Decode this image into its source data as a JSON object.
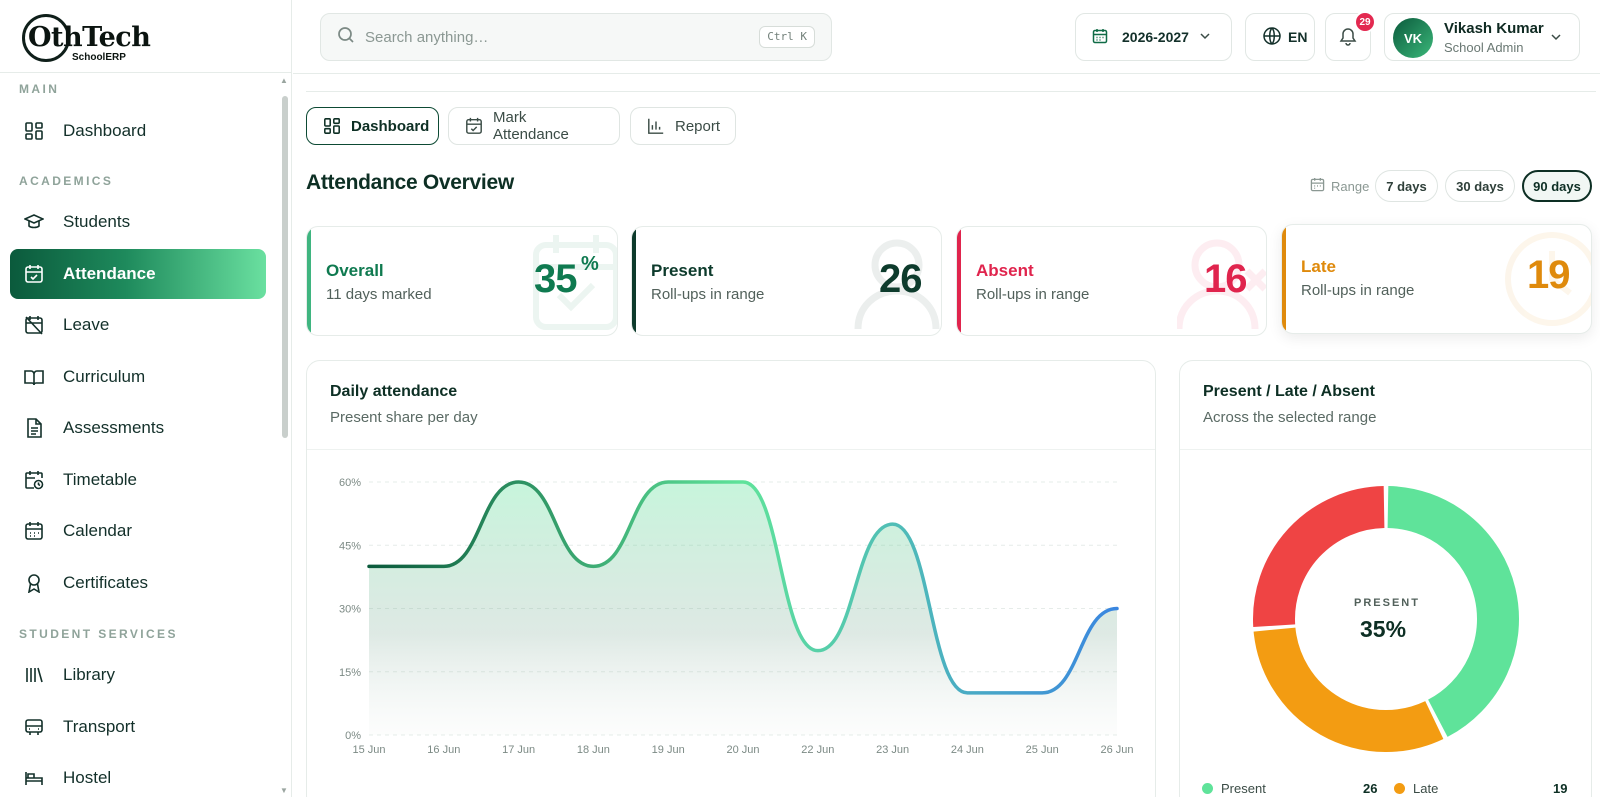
{
  "brand": {
    "name": "OthTech",
    "sub": "SchoolERP"
  },
  "sidebar": {
    "sections": [
      {
        "label": "MAIN"
      },
      {
        "label": "ACADEMICS"
      },
      {
        "label": "STUDENT SERVICES"
      }
    ],
    "items": [
      {
        "label": "Dashboard",
        "icon": "dashboard-icon"
      },
      {
        "label": "Students",
        "icon": "graduation-cap-icon"
      },
      {
        "label": "Attendance",
        "icon": "calendar-check-icon",
        "active": true
      },
      {
        "label": "Leave",
        "icon": "calendar-off-icon"
      },
      {
        "label": "Curriculum",
        "icon": "book-open-icon"
      },
      {
        "label": "Assessments",
        "icon": "file-text-icon"
      },
      {
        "label": "Timetable",
        "icon": "calendar-clock-icon"
      },
      {
        "label": "Calendar",
        "icon": "calendar-icon"
      },
      {
        "label": "Certificates",
        "icon": "award-icon"
      },
      {
        "label": "Library",
        "icon": "library-icon"
      },
      {
        "label": "Transport",
        "icon": "bus-icon"
      },
      {
        "label": "Hostel",
        "icon": "bed-icon"
      }
    ]
  },
  "header": {
    "search": {
      "placeholder": "Search anything…",
      "shortcut": "Ctrl K"
    },
    "academic_year": "2026-2027",
    "language": "EN",
    "notifications": {
      "count": "29"
    },
    "user": {
      "initials": "VK",
      "name": "Vikash Kumar",
      "role": "School Admin"
    }
  },
  "tabs": [
    {
      "label": "Dashboard",
      "icon": "dashboard-icon",
      "active": true
    },
    {
      "label": "Mark Attendance",
      "icon": "calendar-check-icon"
    },
    {
      "label": "Report",
      "icon": "bar-chart-icon"
    }
  ],
  "page": {
    "title": "Attendance Overview",
    "range_label": "Range",
    "range_options": [
      {
        "label": "7 days"
      },
      {
        "label": "30 days"
      },
      {
        "label": "90 days",
        "active": true
      }
    ]
  },
  "stats": {
    "overall": {
      "label": "Overall",
      "sub": "11 days marked",
      "value": "35",
      "unit": "%",
      "color": "#0f7a50"
    },
    "present": {
      "label": "Present",
      "sub": "Roll-ups in range",
      "value": "26",
      "color": "#0d3b2c"
    },
    "absent": {
      "label": "Absent",
      "sub": "Roll-ups in range",
      "value": "16",
      "color": "#e0244d"
    },
    "late": {
      "label": "Late",
      "sub": "Roll-ups in range",
      "value": "19",
      "color": "#df8a0c"
    }
  },
  "daily_card": {
    "title": "Daily attendance",
    "subtitle": "Present share per day"
  },
  "breakdown_card": {
    "title": "Present / Late / Absent",
    "subtitle": "Across the selected range",
    "center_label": "PRESENT",
    "center_value": "35%",
    "legend": [
      {
        "label": "Present",
        "value": "26",
        "color": "#5fe39a"
      },
      {
        "label": "Late",
        "value": "19",
        "color": "#f39c12"
      }
    ]
  },
  "chart_data": [
    {
      "type": "area",
      "categories": [
        "15 Jun",
        "16 Jun",
        "17 Jun",
        "18 Jun",
        "19 Jun",
        "20 Jun",
        "22 Jun",
        "23 Jun",
        "24 Jun",
        "25 Jun",
        "26 Jun"
      ],
      "values": [
        40,
        40,
        60,
        40,
        60,
        60,
        20,
        50,
        10,
        10,
        30
      ],
      "y_ticks": [
        "0%",
        "15%",
        "30%",
        "45%",
        "60%"
      ],
      "ylim": [
        0,
        60
      ],
      "grid": true
    },
    {
      "type": "pie",
      "labels": [
        "Present",
        "Late",
        "Absent"
      ],
      "values": [
        26,
        19,
        16
      ],
      "colors": [
        "#5fe39a",
        "#f39c12",
        "#ef4444"
      ]
    }
  ]
}
